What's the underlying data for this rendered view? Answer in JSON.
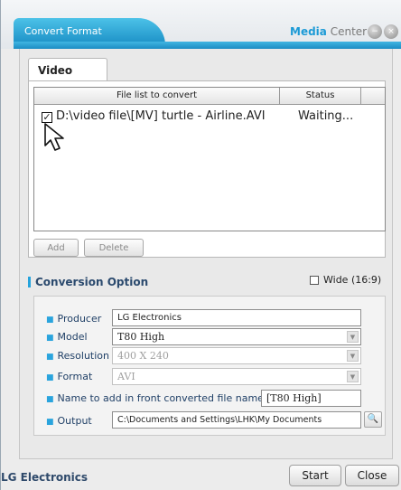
{
  "window": {
    "title": "Convert Format",
    "brand_accent": "Media",
    "brand_rest": " Center",
    "accent_color": "#1c9ad6"
  },
  "tabs": [
    {
      "label": "Video",
      "active": true
    }
  ],
  "file_list": {
    "columns": [
      "File list to convert",
      "Status"
    ],
    "rows": [
      {
        "checked": true,
        "file": "D:\\video file\\[MV] turtle - Airline.AVI",
        "status": "Waiting..."
      }
    ]
  },
  "list_buttons": {
    "add": "Add",
    "delete": "Delete"
  },
  "conversion": {
    "title": "Conversion Option",
    "wide_label": "Wide (16:9)",
    "wide_checked": false,
    "producer_label": "Producer",
    "producer_value": "LG Electronics",
    "model_label": "Model",
    "model_value": "T80 High",
    "resolution_label": "Resolution",
    "resolution_value": "400 X 240",
    "format_label": "Format",
    "format_value": "AVI",
    "prefix_label": "Name to add in front converted file name",
    "prefix_value": "[T80 High]",
    "output_label": "Output",
    "output_value": "C:\\Documents and Settings\\LHK\\My Documents"
  },
  "footer": {
    "brand": "LG Electronics",
    "start": "Start",
    "close": "Close"
  },
  "icons": {
    "minimize": "minimize-icon",
    "close": "close-icon",
    "browse": "magnifier-icon",
    "dropdown": "chevron-down-icon"
  }
}
